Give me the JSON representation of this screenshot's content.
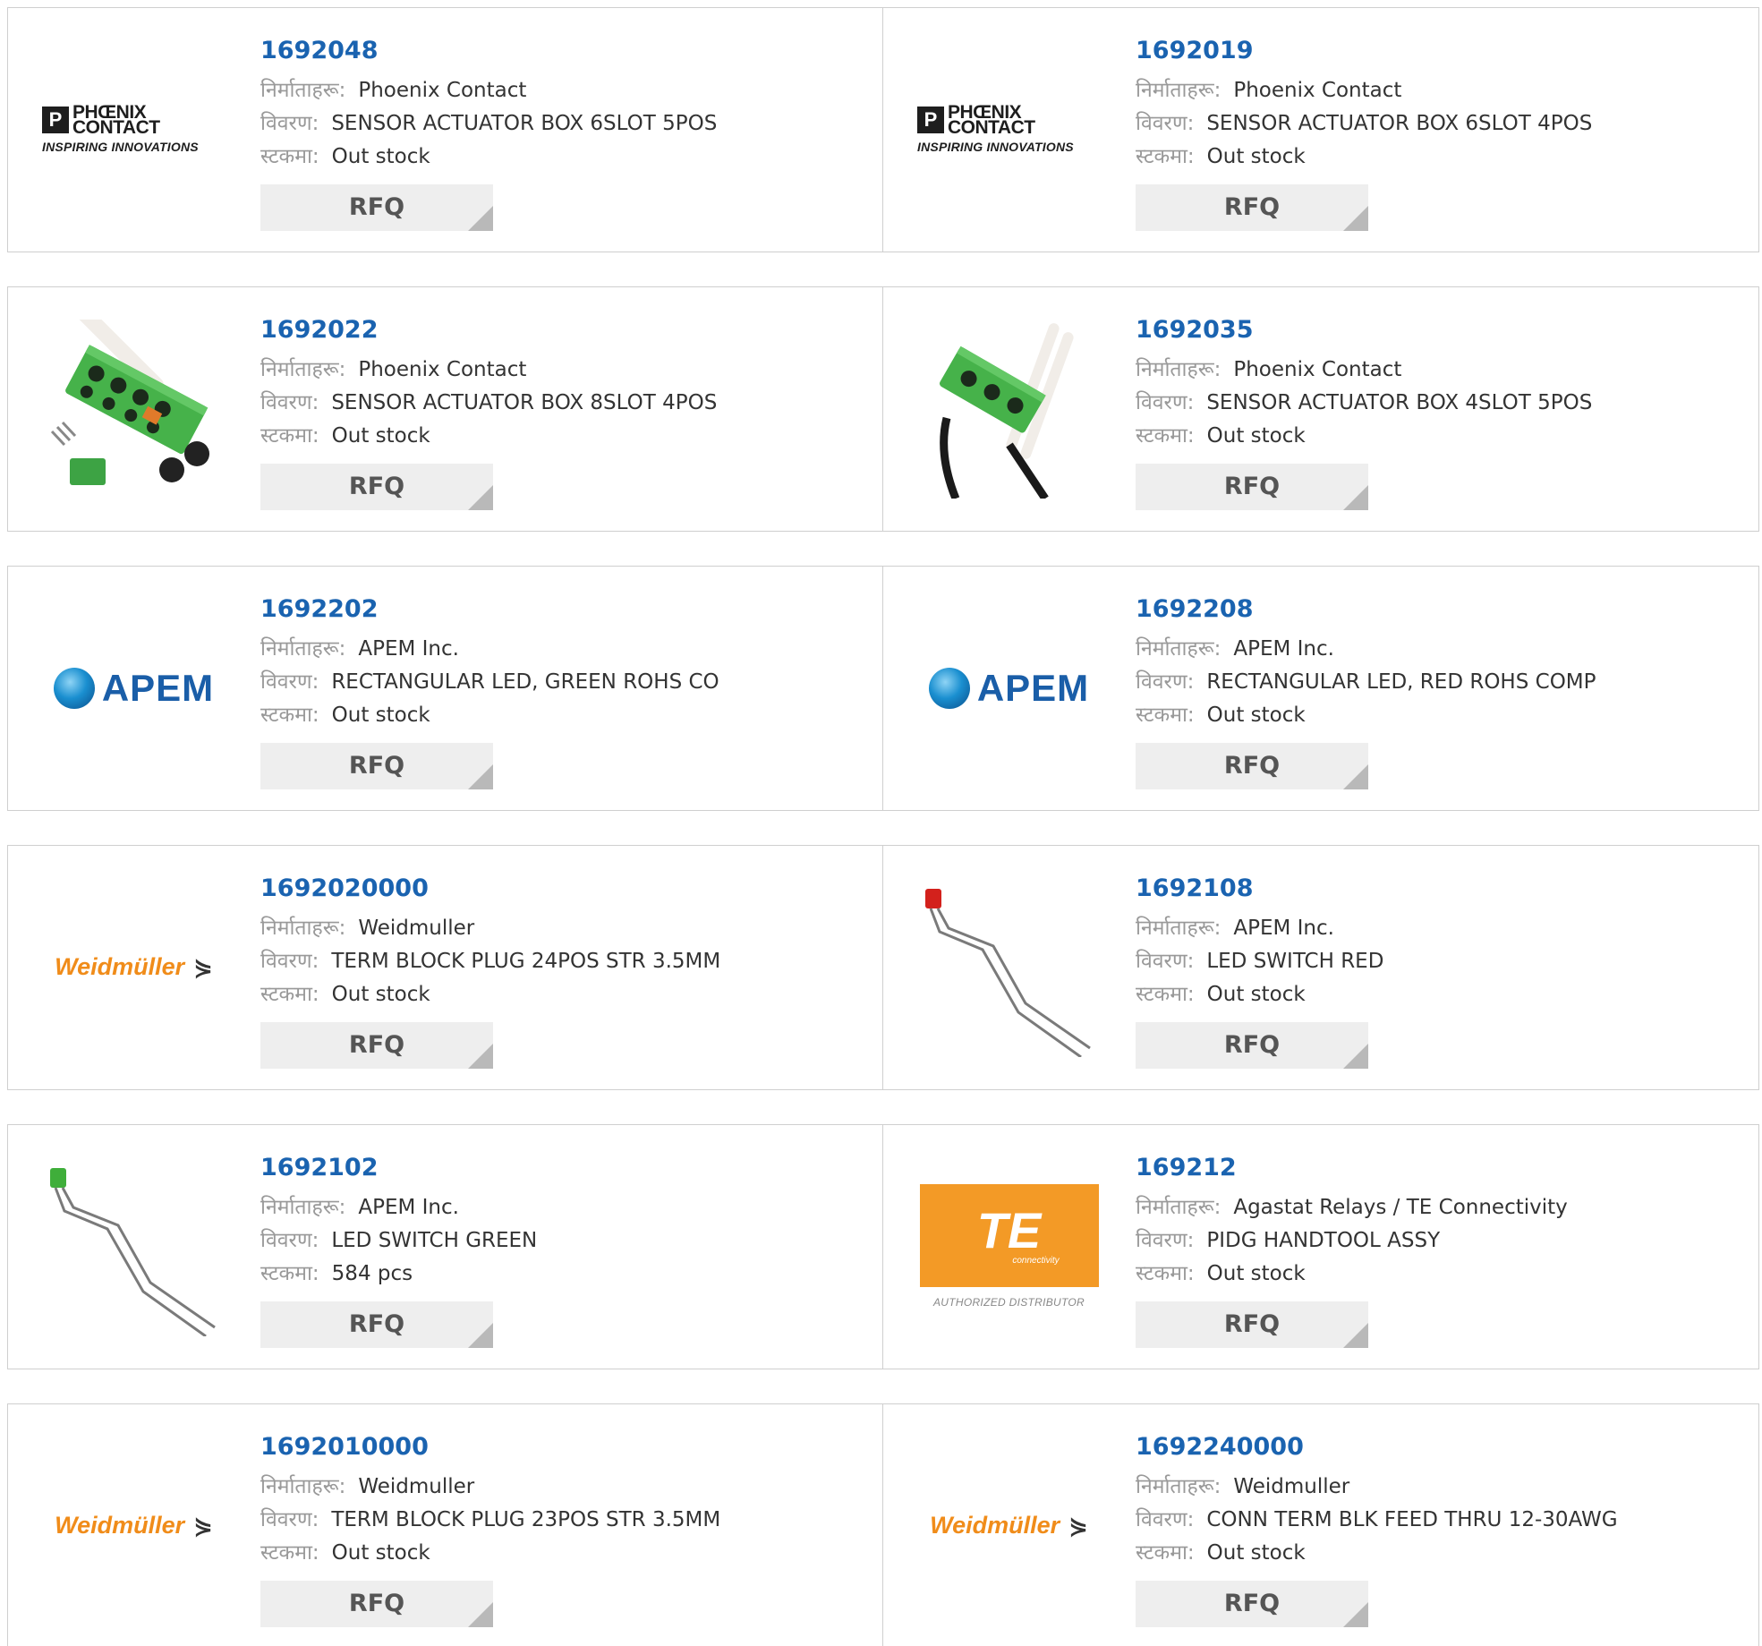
{
  "labels": {
    "manufacturer": "निर्माताहरू:",
    "description": "विवरण:",
    "stock": "स्टकमा:",
    "rfq": "RFQ"
  },
  "colors": {
    "part_number_link": "#1a63b0",
    "rfq_button_bg": "#eeeeee",
    "border": "#cfcfcf"
  },
  "products": [
    {
      "part": "1692048",
      "manufacturer": "Phoenix Contact",
      "description": "SENSOR ACTUATOR BOX 6SLOT 5POS",
      "stock": "Out stock",
      "image": "phoenix-contact-logo",
      "logo": {
        "line1": "PHŒNIX",
        "line2": "CONTACT",
        "tagline": "INSPIRING INNOVATIONS"
      }
    },
    {
      "part": "1692019",
      "manufacturer": "Phoenix Contact",
      "description": "SENSOR ACTUATOR BOX 6SLOT 4POS",
      "stock": "Out stock",
      "image": "phoenix-contact-logo",
      "logo": {
        "line1": "PHŒNIX",
        "line2": "CONTACT",
        "tagline": "INSPIRING INNOVATIONS"
      }
    },
    {
      "part": "1692022",
      "manufacturer": "Phoenix Contact",
      "description": "SENSOR ACTUATOR BOX 8SLOT 4POS",
      "stock": "Out stock",
      "image": "sensor-box-8slot-photo"
    },
    {
      "part": "1692035",
      "manufacturer": "Phoenix Contact",
      "description": "SENSOR ACTUATOR BOX 4SLOT 5POS",
      "stock": "Out stock",
      "image": "sensor-box-4slot-photo"
    },
    {
      "part": "1692202",
      "manufacturer": "APEM Inc.",
      "description": "RECTANGULAR LED, GREEN ROHS CO",
      "stock": "Out stock",
      "image": "apem-logo",
      "logo": {
        "text": "APEM"
      }
    },
    {
      "part": "1692208",
      "manufacturer": "APEM Inc.",
      "description": "RECTANGULAR LED, RED ROHS COMP",
      "stock": "Out stock",
      "image": "apem-logo",
      "logo": {
        "text": "APEM"
      }
    },
    {
      "part": "1692020000",
      "manufacturer": "Weidmuller",
      "description": "TERM BLOCK PLUG 24POS STR 3.5MM",
      "stock": "Out stock",
      "image": "weidmuller-logo",
      "logo": {
        "text": "Weidmüller"
      }
    },
    {
      "part": "1692108",
      "manufacturer": "APEM Inc.",
      "description": "LED SWITCH RED",
      "stock": "Out stock",
      "image": "red-led-photo"
    },
    {
      "part": "1692102",
      "manufacturer": "APEM Inc.",
      "description": "LED SWITCH GREEN",
      "stock": "584 pcs",
      "image": "green-led-photo"
    },
    {
      "part": "169212",
      "manufacturer": "Agastat Relays / TE Connectivity",
      "description": "PIDG HANDTOOL ASSY",
      "stock": "Out stock",
      "image": "te-connectivity-logo",
      "logo": {
        "main": "TE",
        "sub": "connectivity",
        "tagline": "AUTHORIZED DISTRIBUTOR"
      }
    },
    {
      "part": "1692010000",
      "manufacturer": "Weidmuller",
      "description": "TERM BLOCK PLUG 23POS STR 3.5MM",
      "stock": "Out stock",
      "image": "weidmuller-logo",
      "logo": {
        "text": "Weidmüller"
      }
    },
    {
      "part": "1692240000",
      "manufacturer": "Weidmuller",
      "description": "CONN TERM BLK FEED THRU 12-30AWG",
      "stock": "Out stock",
      "image": "weidmuller-logo",
      "logo": {
        "text": "Weidmüller"
      }
    }
  ]
}
